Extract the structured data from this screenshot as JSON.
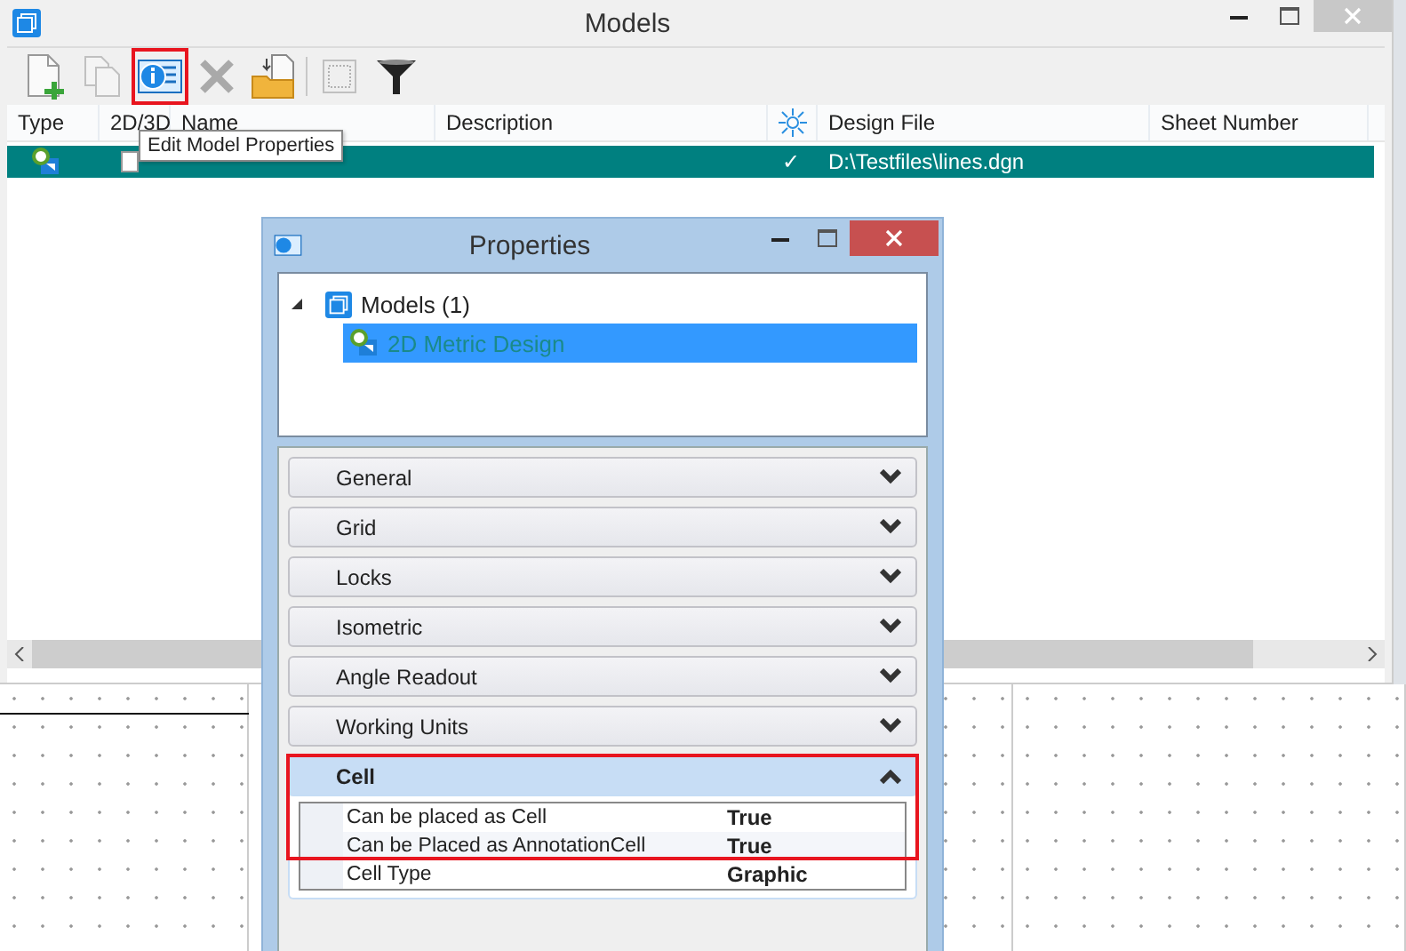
{
  "models_window": {
    "title": "Models",
    "toolbar": [
      {
        "kind": "new",
        "disabled": false,
        "highlighted": false
      },
      {
        "kind": "copy",
        "disabled": true,
        "highlighted": false
      },
      {
        "kind": "properties",
        "disabled": false,
        "highlighted": true
      },
      {
        "kind": "delete",
        "disabled": true,
        "highlighted": false
      },
      {
        "kind": "import",
        "disabled": false,
        "highlighted": false
      },
      {
        "kind": "separator"
      },
      {
        "kind": "select",
        "disabled": true,
        "highlighted": false
      },
      {
        "kind": "filter",
        "disabled": false,
        "highlighted": false
      }
    ],
    "tooltip": "Edit Model Properties",
    "table": {
      "columns": [
        {
          "kind": "text",
          "label": "Type"
        },
        {
          "kind": "text",
          "label": "2D/3D"
        },
        {
          "kind": "text",
          "label": "Name"
        },
        {
          "kind": "text",
          "label": "Description"
        },
        {
          "kind": "icon"
        },
        {
          "kind": "text",
          "label": "Design File"
        },
        {
          "kind": "text",
          "label": "Sheet Number"
        }
      ],
      "rows": [
        {
          "selected": true,
          "active": "✓",
          "design_file": "D:\\Testfiles\\lines.dgn"
        }
      ]
    }
  },
  "properties_window": {
    "title": "Properties",
    "tree": [
      {
        "label": "Models (1)",
        "expanded": true,
        "children": [
          {
            "label": "2D Metric Design",
            "selected": true
          }
        ]
      }
    ],
    "sections": [
      {
        "label": "General",
        "expanded": false,
        "highlighted": false
      },
      {
        "label": "Grid",
        "expanded": false,
        "highlighted": false
      },
      {
        "label": "Locks",
        "expanded": false,
        "highlighted": false
      },
      {
        "label": "Isometric",
        "expanded": false,
        "highlighted": false
      },
      {
        "label": "Angle Readout",
        "expanded": false,
        "highlighted": false
      },
      {
        "label": "Working Units",
        "expanded": false,
        "highlighted": false
      },
      {
        "label": "Cell",
        "expanded": true,
        "highlighted": true,
        "properties": [
          {
            "label": "Can be placed as Cell",
            "value": "True"
          },
          {
            "label": "Can be Placed as AnnotationCell",
            "value": "True"
          },
          {
            "label": "Cell Type",
            "value": "Graphic"
          }
        ]
      }
    ]
  }
}
